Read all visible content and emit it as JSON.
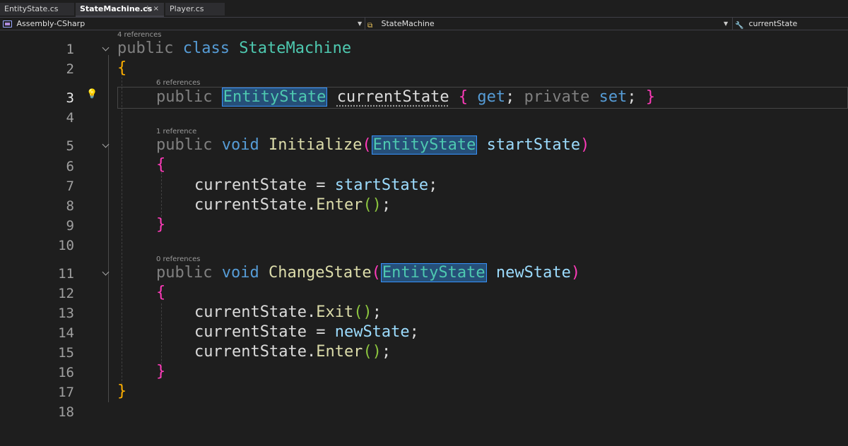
{
  "tabs": [
    {
      "label": "EntityState.cs",
      "active": false
    },
    {
      "label": "StateMachine.cs",
      "active": true
    },
    {
      "label": "Player.cs",
      "active": false
    }
  ],
  "tab_pin_glyph": "⊣",
  "tab_close_glyph": "×",
  "navbar": {
    "project": "Assembly-CSharp",
    "type": "StateMachine",
    "member": "currentState"
  },
  "code": {
    "line_numbers": [
      "1",
      "2",
      "3",
      "4",
      "5",
      "6",
      "7",
      "8",
      "9",
      "10",
      "11",
      "12",
      "13",
      "14",
      "15",
      "16",
      "17",
      "18"
    ],
    "current_line": "3",
    "codelens": {
      "class": "4 references",
      "current_state": "6 references",
      "initialize": "1 reference",
      "change_state": "0 references"
    },
    "lines": {
      "l1": {
        "kw1": "public",
        "kw2": "class",
        "name": "StateMachine"
      },
      "l2": {
        "brace": "{"
      },
      "l3": {
        "kw1": "public",
        "type": "EntityState",
        "name": "currentState",
        "open": "{",
        "get": "get",
        "semi1": ";",
        "priv": "private",
        "set": "set",
        "semi2": ";",
        "close": "}"
      },
      "l5": {
        "kw1": "public",
        "kw2": "void",
        "method": "Initialize",
        "open": "(",
        "type": "EntityState",
        "param": "startState",
        "close": ")"
      },
      "l6": {
        "brace": "{"
      },
      "l7": {
        "lhs": "currentState",
        "op": " = ",
        "rhs": "startState",
        "end": ";"
      },
      "l8": {
        "obj": "currentState",
        "dot": ".",
        "method": "Enter",
        "paren": "()",
        "end": ";"
      },
      "l9": {
        "brace": "}"
      },
      "l11": {
        "kw1": "public",
        "kw2": "void",
        "method": "ChangeState",
        "open": "(",
        "type": "EntityState",
        "param": "newState",
        "close": ")"
      },
      "l12": {
        "brace": "{"
      },
      "l13": {
        "obj": "currentState",
        "dot": ".",
        "method": "Exit",
        "paren": "()",
        "end": ";"
      },
      "l14": {
        "lhs": "currentState",
        "op": " = ",
        "rhs": "newState",
        "end": ";"
      },
      "l15": {
        "obj": "currentState",
        "dot": ".",
        "method": "Enter",
        "paren": "()",
        "end": ";"
      },
      "l16": {
        "brace": "}"
      },
      "l17": {
        "brace": "}"
      }
    }
  },
  "colors": {
    "keyword": "#569cd6",
    "type": "#4ec9b0",
    "method": "#dcdcaa",
    "parameter": "#9cdcfe",
    "brace_level1": "#ffb000",
    "brace_level2": "#ff3bba",
    "brace_level3": "#8dc63f",
    "background": "#1e1e1e"
  },
  "icons": {
    "project": "csharp-project-icon",
    "type": "class-icon",
    "member": "wrench-property-icon",
    "fold": "chevron-down-icon",
    "lightbulb": "lightbulb-icon"
  }
}
